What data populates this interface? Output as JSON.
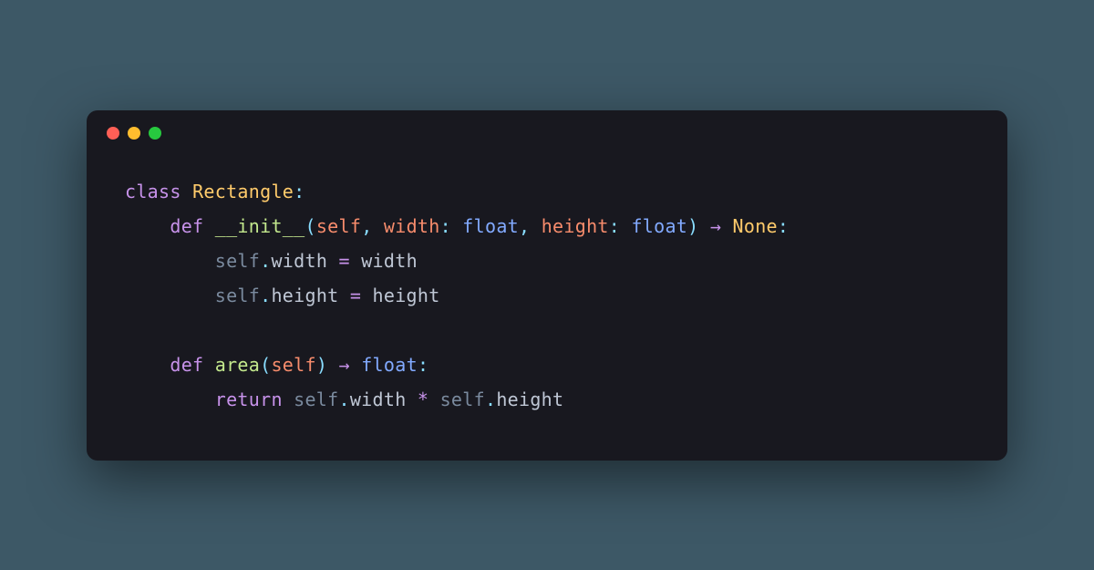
{
  "window": {
    "controls": [
      "close",
      "minimize",
      "zoom"
    ]
  },
  "code": {
    "line1": {
      "kw_class": "class",
      "class_name": "Rectangle",
      "colon": ":"
    },
    "line2": {
      "indent": "    ",
      "kw_def": "def",
      "fn_name": "__init__",
      "open_paren": "(",
      "self": "self",
      "comma1": ", ",
      "param1": "width",
      "colon1": ": ",
      "type1": "float",
      "comma2": ", ",
      "param2": "height",
      "colon2": ": ",
      "type2": "float",
      "close_paren": ")",
      "arrow": " → ",
      "ret_type": "None",
      "colon_end": ":"
    },
    "line3": {
      "indent": "        ",
      "self": "self",
      "dot": ".",
      "prop": "width",
      "assign": " = ",
      "val": "width"
    },
    "line4": {
      "indent": "        ",
      "self": "self",
      "dot": ".",
      "prop": "height",
      "assign": " = ",
      "val": "height"
    },
    "line6": {
      "indent": "    ",
      "kw_def": "def",
      "fn_name": "area",
      "open_paren": "(",
      "self": "self",
      "close_paren": ")",
      "arrow": " → ",
      "ret_type": "float",
      "colon_end": ":"
    },
    "line7": {
      "indent": "        ",
      "kw_return": "return",
      "space": " ",
      "self1": "self",
      "dot1": ".",
      "prop1": "width",
      "mult": " * ",
      "self2": "self",
      "dot2": ".",
      "prop2": "height"
    }
  }
}
